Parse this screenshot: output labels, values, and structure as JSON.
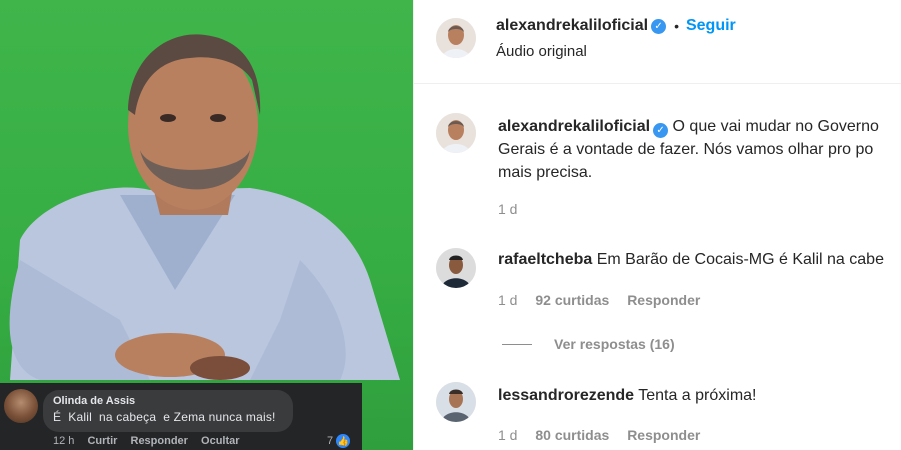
{
  "video": {
    "fb_comment": {
      "name": "Olinda de Assis",
      "text": "É  Kalil  na cabeça  e Zema nunca mais!",
      "time": "12 h",
      "like_label": "Curtir",
      "reply_label": "Responder",
      "hide_label": "Ocultar",
      "reaction_count": "7"
    }
  },
  "header": {
    "username": "alexandrekaliloficial",
    "separator": "•",
    "follow_label": "Seguir",
    "audio": "Áudio original"
  },
  "caption": {
    "username": "alexandrekaliloficial",
    "line1": "O que vai mudar no Governo",
    "line2": "Gerais é a vontade de fazer. Nós vamos olhar pro po",
    "line3": "mais precisa.",
    "time": "1 d"
  },
  "comments": [
    {
      "username": "rafaeltcheba",
      "text": "Em Barão de Cocais-MG é Kalil na cabe",
      "time": "1 d",
      "likes": "92 curtidas",
      "reply_label": "Responder",
      "view_replies": "Ver respostas (16)"
    },
    {
      "username": "lessandrorezende",
      "text": "Tenta a próxima!",
      "time": "1 d",
      "likes": "80 curtidas",
      "reply_label": "Responder"
    }
  ],
  "colors": {
    "green_screen": "#3fb54a",
    "link_blue": "#0095f6",
    "verified_blue": "#3897f0",
    "muted": "#8e8e8e"
  },
  "icons": {
    "verified": "verified-badge-icon",
    "like": "thumbs-up-icon"
  }
}
